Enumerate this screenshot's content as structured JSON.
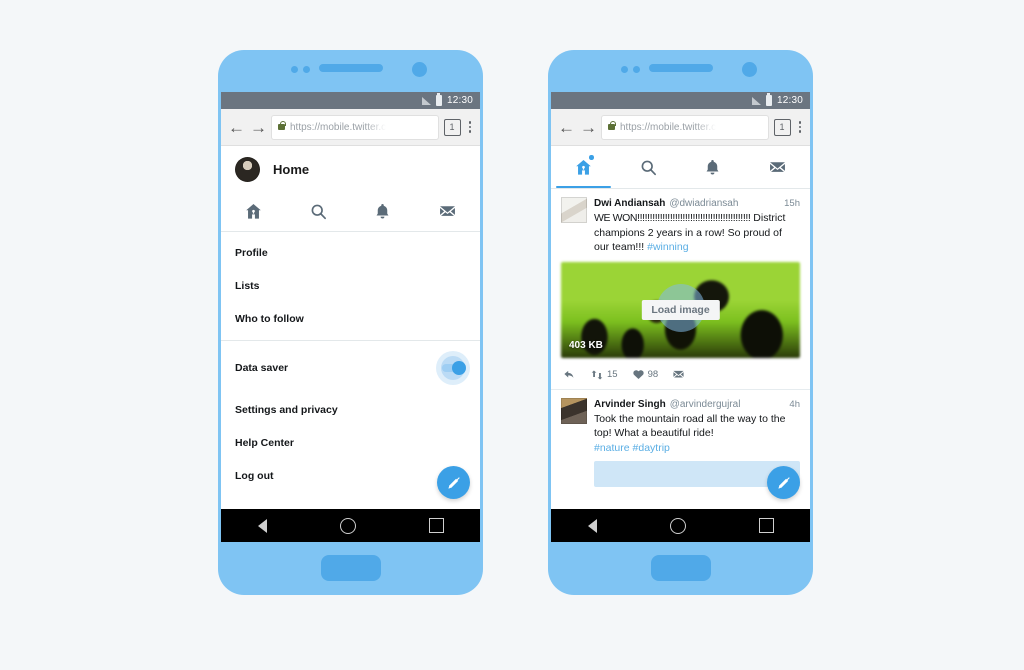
{
  "page": {
    "background_color": "#f4f7f9",
    "phone_frame_color": "#7fc4f3",
    "accent_color": "#3ba0e6"
  },
  "status_bar": {
    "time": "12:30",
    "signal_icon": "signal-bars-icon",
    "battery_icon": "battery-icon"
  },
  "browser": {
    "back_icon": "←",
    "forward_icon": "→",
    "lock_icon": "lock-icon",
    "url": "https://mobile.twitter.c",
    "tab_count": "1",
    "menu_icon": "kebab-menu-icon"
  },
  "left_phone": {
    "header": {
      "title": "Home",
      "avatar": "user-avatar"
    },
    "tabs": [
      {
        "name": "home",
        "icon": "home-icon",
        "active": false
      },
      {
        "name": "search",
        "icon": "search-icon",
        "active": false
      },
      {
        "name": "notifications",
        "icon": "bell-icon",
        "active": false
      },
      {
        "name": "messages",
        "icon": "envelope-icon",
        "active": false
      }
    ],
    "menu": [
      {
        "label": "Profile",
        "toggle": false
      },
      {
        "label": "Lists",
        "toggle": false
      },
      {
        "label": "Who to follow",
        "toggle": false
      },
      {
        "label": "Data saver",
        "toggle": true,
        "toggle_state": "on"
      },
      {
        "label": "Settings and privacy",
        "toggle": false
      },
      {
        "label": "Help Center",
        "toggle": false
      },
      {
        "label": "Log out",
        "toggle": false
      }
    ],
    "compose_button": "compose-tweet",
    "android_nav": [
      "back",
      "home",
      "recents"
    ]
  },
  "right_phone": {
    "tabs": [
      {
        "name": "home",
        "icon": "home-icon",
        "active": true,
        "badge": true
      },
      {
        "name": "search",
        "icon": "search-icon",
        "active": false,
        "badge": false
      },
      {
        "name": "notifications",
        "icon": "bell-icon",
        "active": false,
        "badge": false
      },
      {
        "name": "messages",
        "icon": "envelope-icon",
        "active": false,
        "badge": false
      }
    ],
    "tweets": [
      {
        "name": "Dwi Andiansah",
        "handle": "@dwiadriansah",
        "time": "15h",
        "text_line1": "WE WON!!!!!!!!!!!!!!!!!!!!!!!!!!!!!!!!!!!!!!!!!!!!!",
        "text_line2": "District champions 2 years in a row! So proud of our team!!! ",
        "hashtags": "#winning",
        "media": {
          "load_button_label": "Load image",
          "size_label": "403 KB"
        },
        "actions": {
          "reply_icon": "reply-icon",
          "retweet_icon": "retweet-icon",
          "retweet_count": "15",
          "like_icon": "heart-icon",
          "like_count": "98",
          "share_icon": "envelope-icon"
        }
      },
      {
        "name": "Arvinder Singh",
        "handle": "@arvindergujral",
        "time": "4h",
        "text_line1": "Took the mountain road all the way to the top! What a beautiful ride!",
        "text_line2": "",
        "hashtags": "#nature #daytrip"
      }
    ],
    "compose_button": "compose-tweet",
    "android_nav": [
      "back",
      "home",
      "recents"
    ]
  }
}
